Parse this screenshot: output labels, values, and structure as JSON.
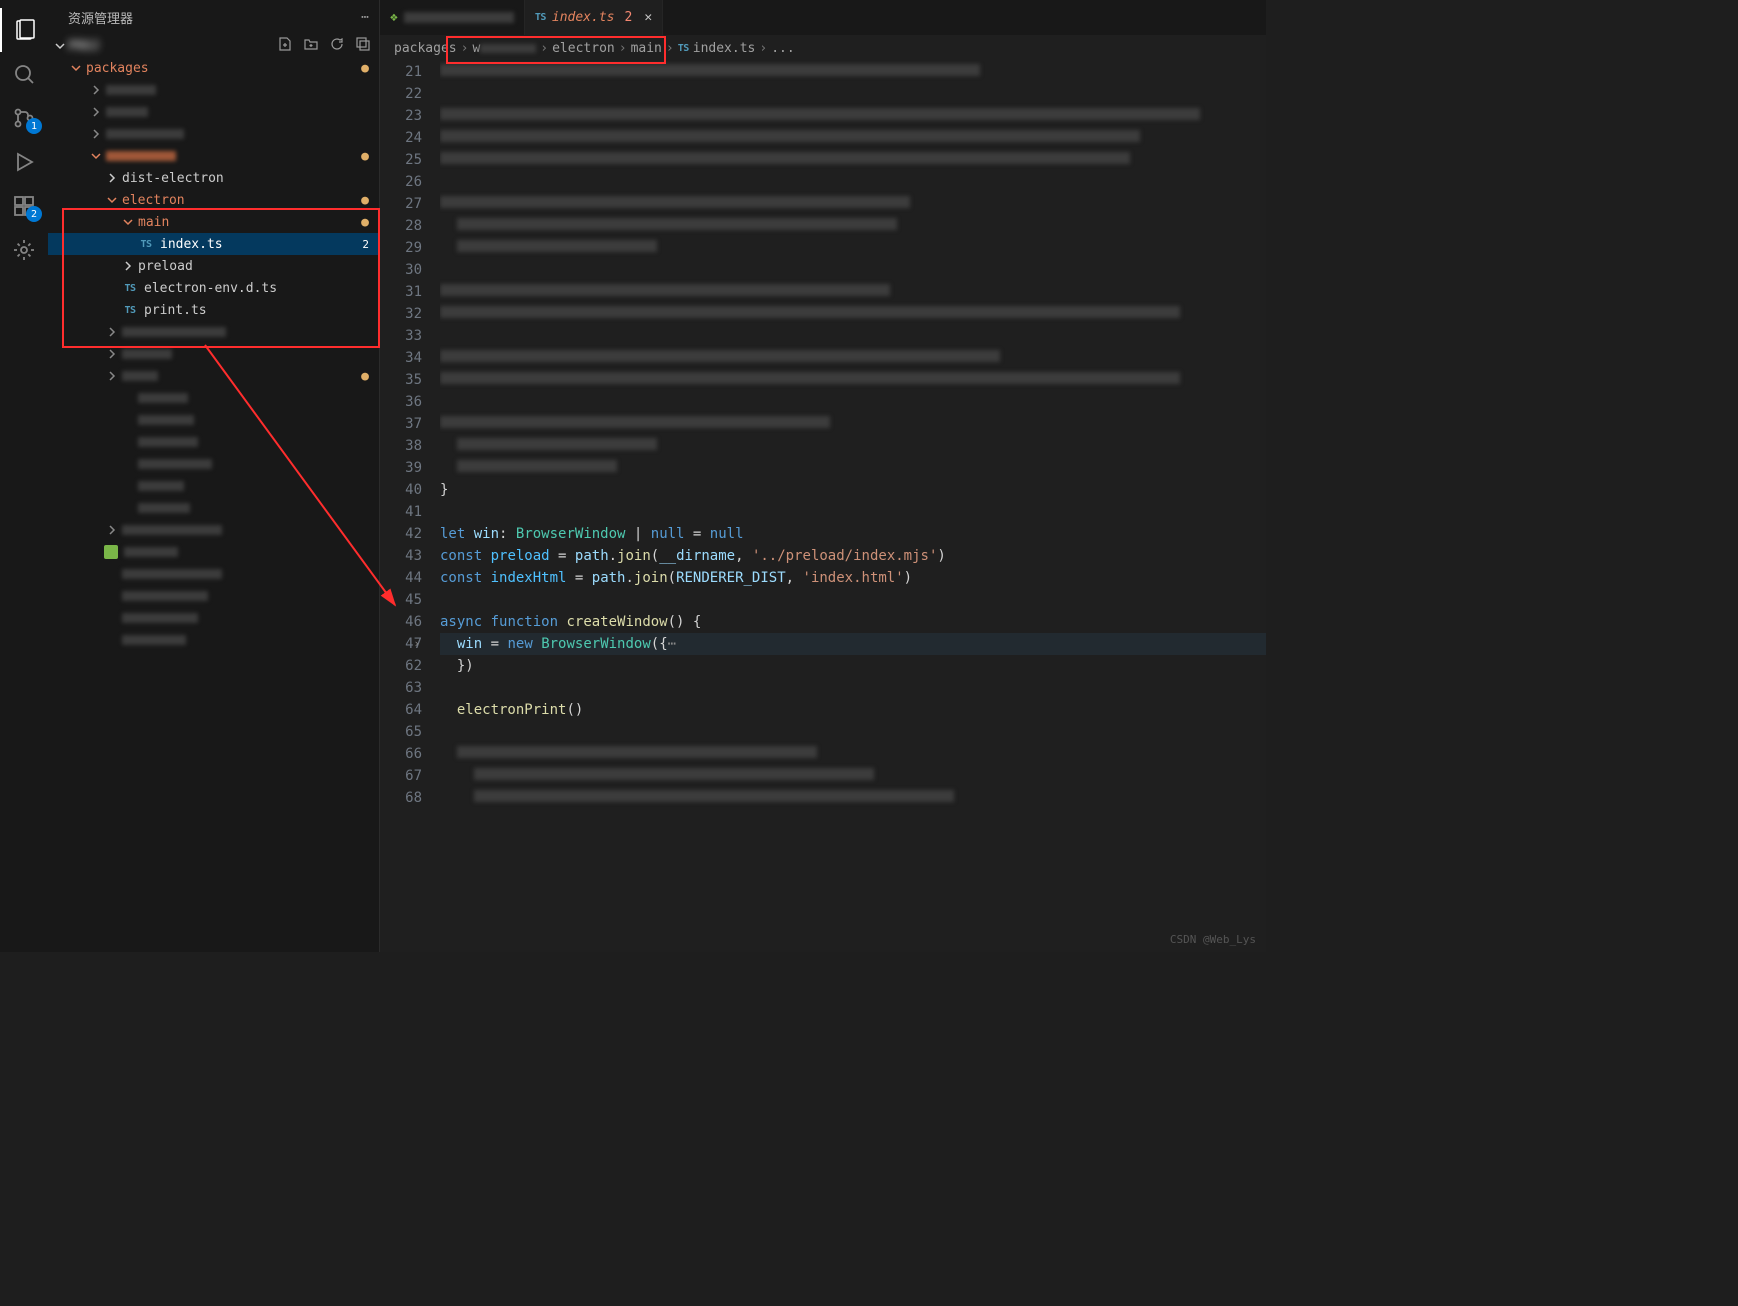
{
  "sidebar": {
    "title": "资源管理器",
    "section_label": "(项目)",
    "packages_label": "packages",
    "folders": {
      "dist_electron": "dist-electron",
      "electron": "electron",
      "main": "main",
      "preload": "preload"
    },
    "files": {
      "index_ts": "index.ts",
      "index_badge": "2",
      "electron_env": "electron-env.d.ts",
      "print_ts": "print.ts"
    }
  },
  "activity": {
    "scm_badge": "1",
    "ext_badge": "2"
  },
  "tabs": {
    "tab1_label": "[隐藏的标签]",
    "tab2_label": "index.ts",
    "tab2_count": "2",
    "ts_icon": "TS"
  },
  "breadcrumbs": {
    "seg1": "packages",
    "seg2": "w",
    "seg3": "electron",
    "seg4": "main",
    "seg5": "index.ts",
    "more": "..."
  },
  "code": {
    "lines": {
      "21": "process.env.APP_ROOT = path.join(__dirname, '../..')",
      "42_let": "let",
      "42_win": "win",
      "42_type": "BrowserWindow",
      "42_null": "null",
      "42_eq": " = ",
      "42_nullv": "null",
      "43_const": "const",
      "43_preload": "preload",
      "43_path": "path",
      "43_join": "join",
      "43_dirname": "__dirname",
      "43_str": "'../preload/index.mjs'",
      "44_const": "const",
      "44_idx": "indexHtml",
      "44_path": "path",
      "44_join": "join",
      "44_rd": "RENDERER_DIST",
      "44_str": "'index.html'",
      "46_async": "async",
      "46_func": "function",
      "46_name": "createWindow",
      "47_win": "win",
      "47_new": "new",
      "47_bw": "BrowserWindow",
      "62_close": "})",
      "64_fn": "electronPrint",
      "64_paren": "()"
    },
    "gutter": [
      "21",
      "22",
      "23",
      "24",
      "25",
      "26",
      "27",
      "28",
      "29",
      "30",
      "31",
      "32",
      "33",
      "34",
      "35",
      "36",
      "37",
      "38",
      "39",
      "40",
      "41",
      "42",
      "43",
      "44",
      "45",
      "46",
      "47",
      "62",
      "63",
      "64",
      "65",
      "66",
      "67",
      "68"
    ]
  },
  "watermark": "CSDN @Web_Lys"
}
